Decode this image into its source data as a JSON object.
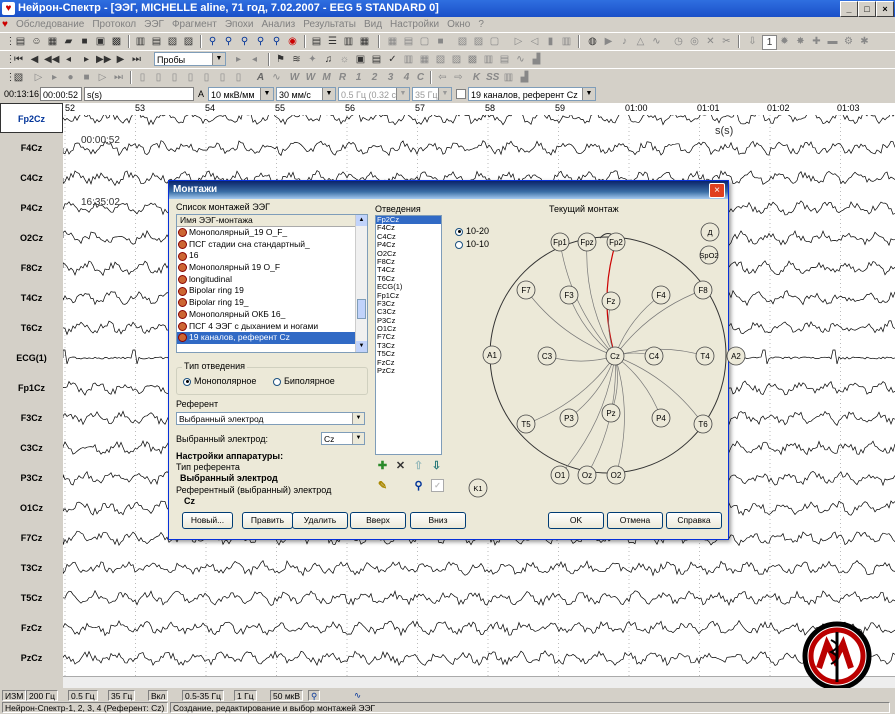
{
  "window": {
    "title": "Нейрон-Спектр - [ЭЭГ, MICHELLE aline, 71 год, 7.02.2007 - EEG 5 STANDARD 0]",
    "min": "_",
    "max": "□",
    "close": "×"
  },
  "menu": [
    "Обследование",
    "Протокол",
    "ЭЭГ",
    "Фрагмент",
    "Эпохи",
    "Анализ",
    "Результаты",
    "Вид",
    "Настройки",
    "Окно",
    "?"
  ],
  "toolbar": {
    "probes_label": "Пробы"
  },
  "infobar": {
    "time_start": "00:13:16",
    "time_pos": "00:00:52",
    "time_unit": "s(s)",
    "amp_prefix": "A",
    "sensitivity": "10 мкВ/мм",
    "speed": "30 мм/с",
    "lowfreq": "0.5 Гц (0.32 с)",
    "highfreq": "35 Гц",
    "montage": "19 каналов, референт Cz"
  },
  "channels": [
    "Fp2Cz",
    "F4Cz",
    "C4Cz",
    "P4Cz",
    "O2Cz",
    "F8Cz",
    "T4Cz",
    "T6Cz",
    "ECG(1)",
    "Fp1Cz",
    "F3Cz",
    "C3Cz",
    "P3Cz",
    "O1Cz",
    "F7Cz",
    "T3Cz",
    "T5Cz",
    "FzCz",
    "PzCz"
  ],
  "ruler": {
    "ticks": [
      "52",
      "53",
      "54",
      "55",
      "56",
      "57",
      "58",
      "59",
      "01:00",
      "01:01",
      "01:02",
      "01:03"
    ],
    "unit": "s(s)"
  },
  "timestamps": [
    "00:00:52",
    "16:35:02"
  ],
  "dialog": {
    "title": "Монтажи",
    "close": "×",
    "list_label": "Список монтажей ЭЭГ",
    "list_header": "Имя ЭЭГ-монтажа",
    "montages": [
      "Монополярный_19 O_F_",
      "ПСГ стадии сна стандартный_",
      "16",
      "Монополярный 19 O_F",
      "longitudinal",
      "Bipolar ring 19",
      "Bipolar ring 19_",
      "Монополярный ОКБ 16_",
      "ПСГ 4 ЭЭГ с дыханием и ногами",
      "19 каналов, референт Cz"
    ],
    "lead_type_label": "Тип отведения",
    "lead_type_mono": "Монополярное",
    "lead_type_bi": "Биполярное",
    "referent_label": "Референт",
    "referent_value": "Выбранный электрод",
    "selected_electrode_label": "Выбранный электрод:",
    "selected_electrode_value": "Cz",
    "hw_settings_label": "Настройки аппаратуры:",
    "ref_type_label": "Тип референта",
    "ref_type_value": "Выбранный электрод",
    "ref_electrode_label": "Референтный (выбранный) электрод",
    "ref_electrode_value": "Cz",
    "leads_label": "Отведения",
    "leads": [
      "Fp2Cz",
      "F4Cz",
      "C4Cz",
      "P4Cz",
      "O2Cz",
      "F8Cz",
      "T4Cz",
      "T6Cz",
      "ECG(1)",
      "Fp1Cz",
      "F3Cz",
      "C3Cz",
      "P3Cz",
      "O1Cz",
      "F7Cz",
      "T3Cz",
      "T5Cz",
      "FzCz",
      "PzCz"
    ],
    "system_1020": "10-20",
    "system_1010": "10-10",
    "current_montage_label": "Текущий монтаж",
    "electrodes": [
      "Fp1",
      "Fpz",
      "Fp2",
      "F7",
      "F3",
      "Fz",
      "F4",
      "F8",
      "A1",
      "C3",
      "Cz",
      "C4",
      "T4",
      "A2",
      "T5",
      "P3",
      "Pz",
      "P4",
      "T6",
      "O1",
      "Oz",
      "O2"
    ],
    "extra_electrodes": [
      "Д",
      "SpO2",
      "K1"
    ],
    "buttons": {
      "new": "Новый...",
      "edit": "Править",
      "delete": "Удалить",
      "up": "Вверх",
      "down": "Вниз",
      "ok": "OK",
      "cancel": "Отмена",
      "help": "Справка"
    }
  },
  "status": {
    "mode": "ИЗМ",
    "rate": "200 Гц",
    "lf": "0.5 Гц",
    "hf": "35 Гц",
    "notch": "Вкл",
    "band": "0.5-35 Гц",
    "f1": "1 Гц",
    "amp": "50 мкВ",
    "app_text": "Нейрон-Спектр-1, 2, 3, 4 (Референт: Cz)",
    "hint": "Создание, редактирование и выбор монтажей ЭЭГ"
  },
  "colors": {
    "title": "#1a4fc8",
    "selection": "#316ac5",
    "lead_line": "#cc0000"
  }
}
